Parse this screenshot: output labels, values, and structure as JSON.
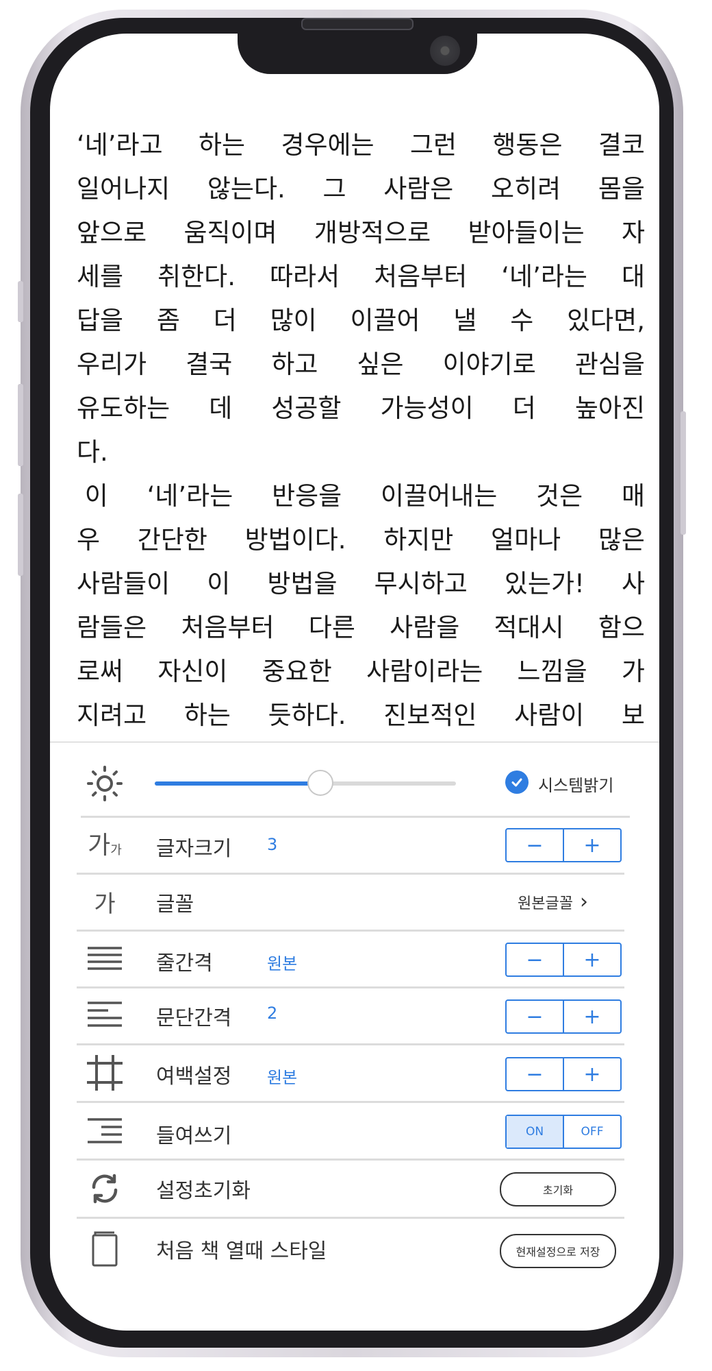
{
  "reader_text": {
    "lines": [
      [
        "‘네’라고",
        "하는",
        "경우에는",
        "그런",
        "행동은",
        "결코"
      ],
      [
        "일어나지",
        "않는다.",
        "그",
        "사람은",
        "오히려",
        "몸을"
      ],
      [
        "앞으로",
        "움직이며",
        "개방적으로",
        "받아들이는",
        "자"
      ],
      [
        "세를",
        "취한다.",
        "따라서",
        "처음부터",
        "‘네’라는",
        "대"
      ],
      [
        "답을",
        "좀",
        "더",
        "많이",
        "이끌어",
        "낼",
        "수",
        "있다면,"
      ],
      [
        "우리가",
        "결국",
        "하고",
        "싶은",
        "이야기로",
        "관심을"
      ],
      [
        "유도하는",
        "데",
        "성공할",
        "가능성이",
        "더",
        "높아진"
      ],
      [
        "다."
      ],
      [
        " 이",
        "‘네’라는",
        "반응을",
        "이끌어내는",
        "것은",
        "매"
      ],
      [
        "우",
        "간단한",
        "방법이다.",
        "하지만",
        "얼마나",
        "많은"
      ],
      [
        "사람들이",
        "이",
        "방법을",
        "무시하고",
        "있는가!",
        "사"
      ],
      [
        "람들은",
        "처음부터",
        "다른",
        "사람을",
        "적대시",
        "함으"
      ],
      [
        "로써",
        "자신이",
        "중요한",
        "사람이라는",
        "느낌을",
        "가"
      ],
      [
        "지려고",
        "하는",
        "듯하다.",
        "진보적인",
        "사람이",
        "보"
      ]
    ]
  },
  "settings": {
    "brightness": {
      "level": 0.55,
      "system_label": "시스템밝기",
      "system_checked": true
    },
    "font_size": {
      "icon_big": "가",
      "icon_small": "가",
      "label": "글자크기",
      "value": "3",
      "minus": "−",
      "plus": "+"
    },
    "font": {
      "icon": "가",
      "label": "글꼴",
      "value": "원본글꼴",
      "chevron": "›"
    },
    "line_spacing": {
      "label": "줄간격",
      "value": "원본",
      "minus": "−",
      "plus": "+"
    },
    "paragraph_spacing": {
      "label": "문단간격",
      "value": "2",
      "minus": "−",
      "plus": "+"
    },
    "margin": {
      "label": "여백설정",
      "value": "원본",
      "minus": "−",
      "plus": "+"
    },
    "indent": {
      "label": "들여쓰기",
      "on": "ON",
      "off": "OFF",
      "selected": "ON"
    },
    "reset": {
      "label": "설정초기화",
      "button": "초기화"
    },
    "first_open_style": {
      "label": "처음 책 열때 스타일",
      "button": "현재설정으로 저장"
    }
  },
  "colors": {
    "accent": "#2f7de1",
    "text": "#1a1a1a",
    "divider": "#dcdcdc"
  }
}
